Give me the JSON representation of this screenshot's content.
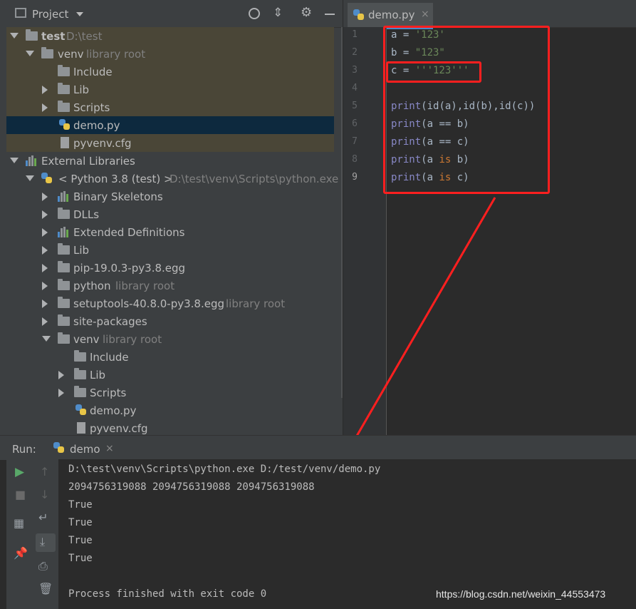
{
  "project_panel": {
    "title": "Project",
    "tree": [
      {
        "label": "test",
        "hint": "D:\\test"
      },
      {
        "label": "venv",
        "hint": "library root"
      },
      {
        "label": "Include"
      },
      {
        "label": "Lib"
      },
      {
        "label": "Scripts"
      },
      {
        "label": "demo.py"
      },
      {
        "label": "pyvenv.cfg"
      },
      {
        "label": "External Libraries"
      },
      {
        "label": "< Python 3.8 (test) >",
        "hint": "D:\\test\\venv\\Scripts\\python.exe"
      },
      {
        "label": "Binary Skeletons"
      },
      {
        "label": "DLLs"
      },
      {
        "label": "Extended Definitions"
      },
      {
        "label": "Lib"
      },
      {
        "label": "pip-19.0.3-py3.8.egg"
      },
      {
        "label": "python",
        "hint": "library root"
      },
      {
        "label": "setuptools-40.8.0-py3.8.egg",
        "hint": "library root"
      },
      {
        "label": "site-packages"
      },
      {
        "label": "venv",
        "hint": "library root"
      },
      {
        "label": "Include"
      },
      {
        "label": "Lib"
      },
      {
        "label": "Scripts"
      },
      {
        "label": "demo.py"
      },
      {
        "label": "pyvenv.cfg"
      }
    ]
  },
  "editor": {
    "tab_label": "demo.py",
    "line_numbers": [
      "1",
      "2",
      "3",
      "4",
      "5",
      "6",
      "7",
      "8",
      "9"
    ],
    "code": {
      "l1_var": "a = ",
      "l1_str": "'123'",
      "l2_var": "b = ",
      "l2_str": "\"123\"",
      "l3_var": "c = ",
      "l3_str": "'''123'''",
      "l5_fn": "print",
      "l5_rest": "(id(a),id(b),id(c))",
      "l6_fn": "print",
      "l6_rest": "(a == b)",
      "l7_fn": "print",
      "l7_rest": "(a == c)",
      "l8_fn": "print",
      "l8_a": "(a ",
      "l8_kw": "is",
      "l8_b": " b)",
      "l9_fn": "print",
      "l9_a": "(a ",
      "l9_kw": "is",
      "l9_b": " c)"
    }
  },
  "run_panel": {
    "label": "Run:",
    "tab_label": "demo",
    "output": [
      "D:\\test\\venv\\Scripts\\python.exe D:/test/venv/demo.py",
      "2094756319088 2094756319088 2094756319088",
      "True",
      "True",
      "True",
      "True",
      "",
      "Process finished with exit code 0"
    ]
  },
  "watermark": "https://blog.csdn.net/weixin_44553473",
  "colors": {
    "highlight_red": "#ff1f1f",
    "library_bg": "#4a4637",
    "selected_bg": "#0d293e"
  }
}
